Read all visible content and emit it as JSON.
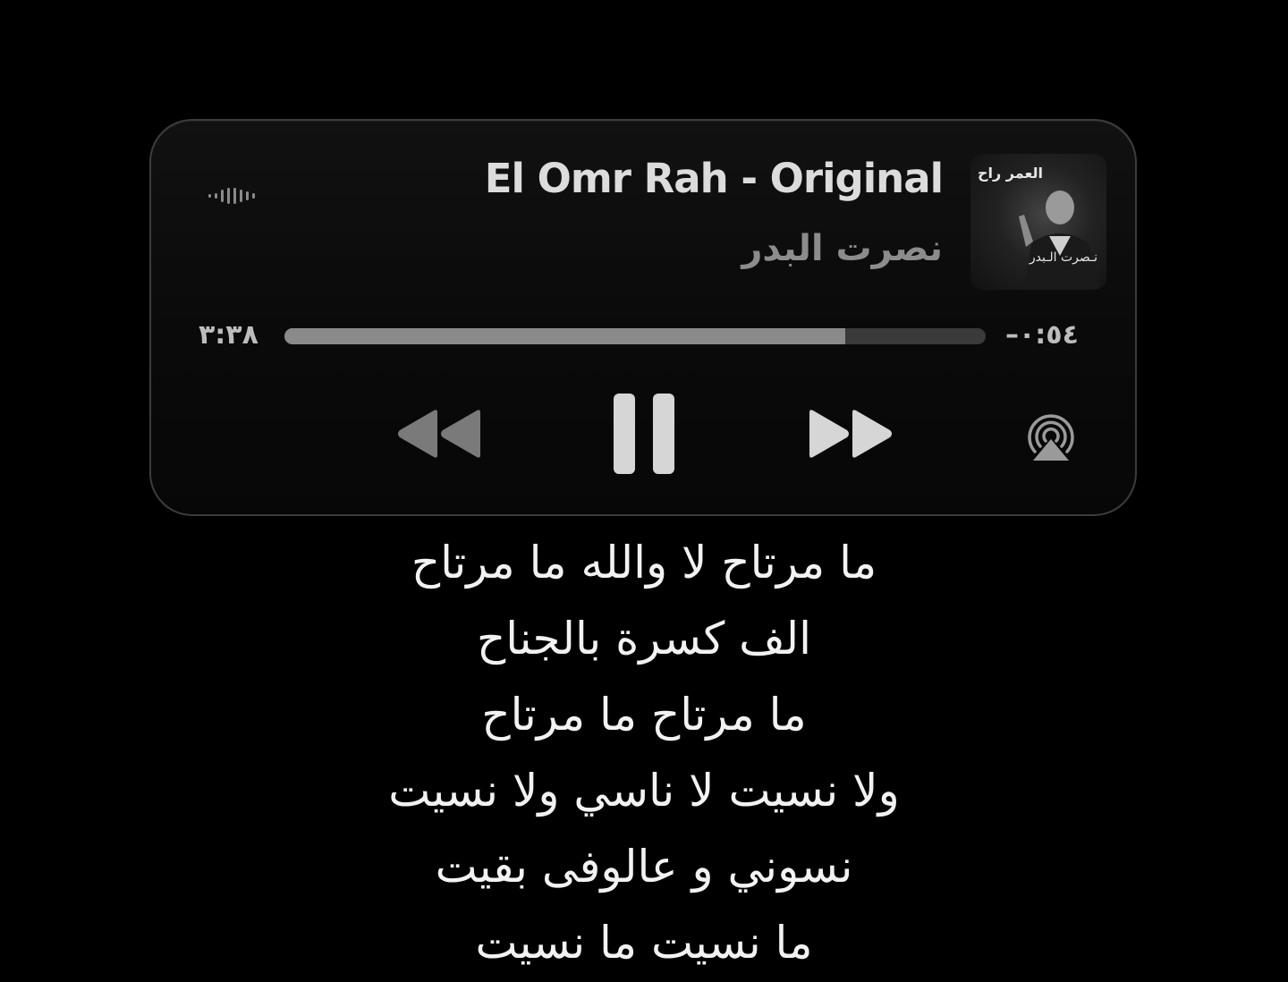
{
  "player": {
    "title": "El Omr Rah - Original",
    "artist": "نصرت البدر",
    "artwork": {
      "top_text": "العمر راح",
      "bottom_text": "نـصرت الـبدر"
    },
    "elapsed": "٣:٣٨",
    "remaining": "–٠:٥٤",
    "progress": 0.8,
    "icons": {
      "waveform": "waveform-icon",
      "rewind": "rewind-icon",
      "pause": "pause-icon",
      "forward": "fast-forward-icon",
      "airplay": "airplay-icon"
    }
  },
  "lyrics": [
    "ما مرتاح لا والله ما مرتاح",
    "الف كسرة بالجناح",
    "ما مرتاح ما مرتاح",
    "ولا نسيت لا ناسي ولا نسيت",
    "نسوني و عالوفى بقيت",
    "ما نسيت ما نسيت"
  ],
  "colors": {
    "background": "#000000",
    "title": "#dcdcdc",
    "artist": "#8c8c8c",
    "progress_fill": "#8a8a8a",
    "progress_track": "#3a3a3a",
    "lyrics": "#f2f2f2"
  }
}
